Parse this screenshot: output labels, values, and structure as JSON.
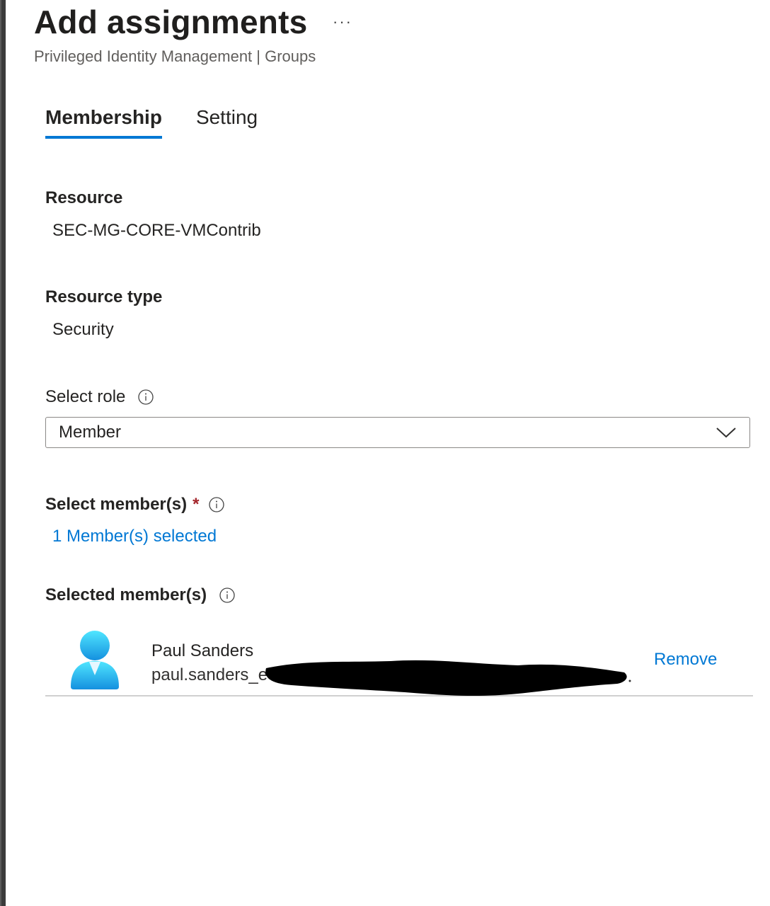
{
  "header": {
    "title": "Add assignments",
    "more_label": "···",
    "subtitle": "Privileged Identity Management | Groups"
  },
  "tabs": [
    {
      "label": "Membership",
      "active": true
    },
    {
      "label": "Setting",
      "active": false
    }
  ],
  "resource": {
    "label": "Resource",
    "value": "SEC-MG-CORE-VMContrib"
  },
  "resource_type": {
    "label": "Resource type",
    "value": "Security"
  },
  "select_role": {
    "label": "Select role",
    "value": "Member",
    "icon": "info-icon"
  },
  "select_members": {
    "label": "Select member(s)",
    "required_mark": "*",
    "link": "1 Member(s) selected",
    "icon": "info-icon"
  },
  "selected_members": {
    "label": "Selected member(s)",
    "icon": "info-icon",
    "items": [
      {
        "name": "Paul Sanders",
        "email_visible": "paul.sanders_e",
        "email_redacted": true,
        "remove_label": "Remove",
        "avatar_icon": "user-avatar-icon"
      }
    ]
  },
  "colors": {
    "accent": "#0078d4",
    "required": "#a4262c",
    "avatar_top": "#50e6ff",
    "avatar_bottom": "#1490df"
  }
}
